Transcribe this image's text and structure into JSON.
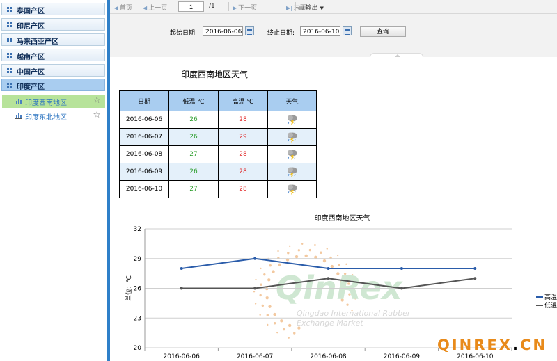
{
  "sidebar": {
    "regions": [
      {
        "label": "泰国产区"
      },
      {
        "label": "印尼产区"
      },
      {
        "label": "马来西亚产区"
      },
      {
        "label": "越南产区"
      },
      {
        "label": "中国产区"
      },
      {
        "label": "印度产区"
      }
    ],
    "subitems": [
      {
        "label": "印度西南地区"
      },
      {
        "label": "印度东北地区"
      }
    ]
  },
  "toolbar": {
    "first": "首页",
    "prev": "上一页",
    "page_value": "1",
    "page_total": "/1",
    "next": "下一页",
    "last": "末页",
    "export": "输出"
  },
  "filter": {
    "start_label": "起始日期:",
    "start_value": "2016-06-06",
    "end_label": "终止日期:",
    "end_value": "2016-06-10",
    "query_label": "查询"
  },
  "report": {
    "title": "印度西南地区天气",
    "headers": [
      "日期",
      "低温 ℃",
      "高温 ℃",
      "天气"
    ],
    "rows": [
      {
        "date": "2016-06-06",
        "low": "26",
        "high": "28"
      },
      {
        "date": "2016-06-07",
        "low": "26",
        "high": "29"
      },
      {
        "date": "2016-06-08",
        "low": "27",
        "high": "28"
      },
      {
        "date": "2016-06-09",
        "low": "26",
        "high": "28"
      },
      {
        "date": "2016-06-10",
        "low": "27",
        "high": "28"
      }
    ],
    "weather_icon": "thunderstorm-icon"
  },
  "chart_data": {
    "type": "line",
    "title": "印度西南地区天气",
    "ylabel": "单位：℃",
    "xlabel": "",
    "ylim": [
      20,
      32
    ],
    "yticks": [
      20,
      23,
      26,
      29,
      32
    ],
    "categories": [
      "2016-06-06",
      "2016-06-07",
      "2016-06-08",
      "2016-06-09",
      "2016-06-10"
    ],
    "series": [
      {
        "name": "高温",
        "values": [
          28,
          29,
          28,
          28,
          28
        ],
        "color": "#2a5caa"
      },
      {
        "name": "低温",
        "values": [
          26,
          26,
          27,
          26,
          27
        ],
        "color": "#555555"
      }
    ],
    "legend": "right",
    "grid": true
  },
  "watermark": {
    "brand": "QinRex",
    "line1": "Qingdao International Rubber",
    "line2": "Exchange Market",
    "url_a": "QINREX",
    "url_dot": ".",
    "url_b": "CN"
  },
  "colors": {
    "accent": "#2f80c9",
    "low": "#2a9d2a",
    "high": "#e02020",
    "header": "#a9cdf0"
  }
}
